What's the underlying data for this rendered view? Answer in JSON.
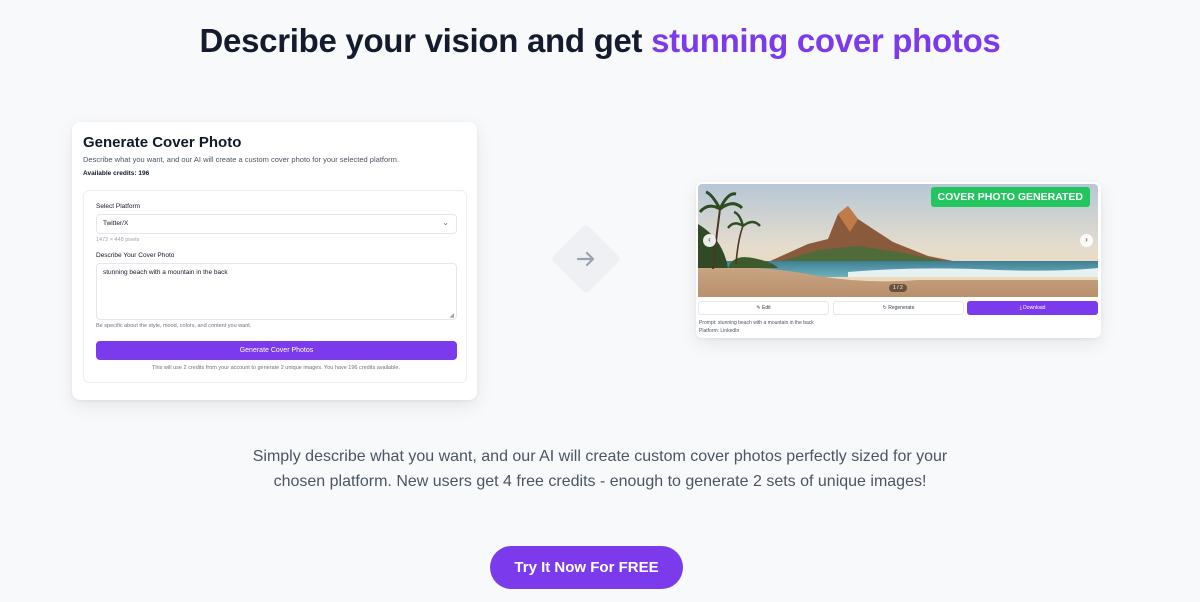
{
  "headline": {
    "part1": "Describe your vision and get ",
    "accent": "stunning cover photos"
  },
  "generator": {
    "title": "Generate Cover Photo",
    "description": "Describe what you want, and our AI will create a custom cover photo for your selected platform.",
    "credits": "Available credits: 196",
    "platform_label": "Select Platform",
    "platform_value": "Twitter/X",
    "platform_size": "1472 × 448 pixels",
    "prompt_label": "Describe Your Cover Photo",
    "prompt_value": "stunning beach with a mountain in the back",
    "prompt_hint": "Be specific about the style, mood, colors, and content you want.",
    "button_label": "Generate Cover Photos",
    "note": "This will use 2 credits from your account to generate 2 unique images. You have 196 credits available."
  },
  "result": {
    "badge": "COVER PHOTO GENERATED",
    "counter": "1 / 2",
    "edit_label": "Edit",
    "regenerate_label": "Regenerate",
    "download_label": "Download",
    "prompt_meta": "Prompt: stunning beach with a mountain in the back",
    "platform_meta": "Platform: LinkedIn"
  },
  "subtitle": "Simply describe what you want, and our AI will create custom cover photos perfectly sized for your chosen platform. New users get 4 free credits - enough to generate 2 sets of unique images!",
  "cta": "Try It Now For FREE",
  "colors": {
    "accent": "#7c3aed",
    "success": "#22c55e",
    "heading": "#141b2d",
    "background": "#f8f9fb"
  }
}
